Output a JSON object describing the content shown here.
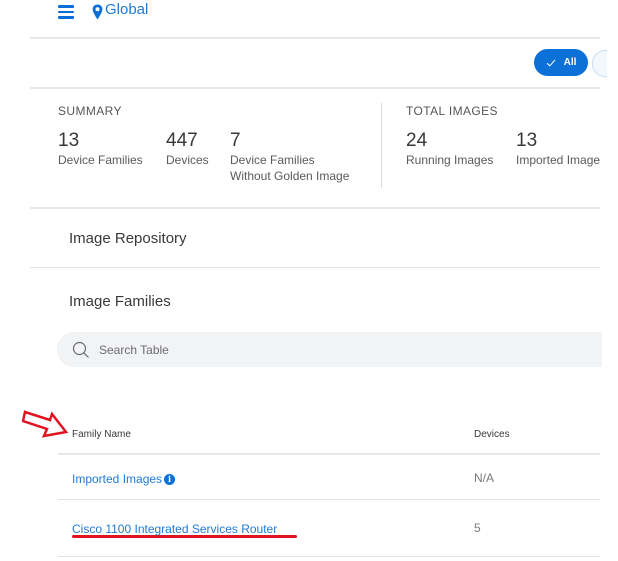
{
  "header": {
    "location_label": "Global"
  },
  "filter": {
    "selected_label": "All"
  },
  "summary": {
    "title": "SUMMARY",
    "metrics": [
      {
        "value": "13",
        "label": "Device Families"
      },
      {
        "value": "447",
        "label": "Devices"
      },
      {
        "value": "7",
        "label": "Device Families",
        "label2": "Without Golden Image"
      }
    ]
  },
  "total_images": {
    "title": "TOTAL IMAGES",
    "metrics": [
      {
        "value": "24",
        "label": "Running Images"
      },
      {
        "value": "13",
        "label": "Imported Images"
      }
    ]
  },
  "sections": {
    "image_repository": "Image Repository",
    "image_families": "Image Families"
  },
  "search": {
    "placeholder": "Search Table",
    "value": ""
  },
  "table": {
    "columns": [
      "Family Name",
      "Devices"
    ],
    "rows": [
      {
        "family_name": "Imported Images",
        "has_info": true,
        "devices": "N/A"
      },
      {
        "family_name": "Cisco 1100 Integrated Services Router",
        "has_info": false,
        "devices": "5"
      }
    ]
  },
  "annotations": {
    "arrow_color": "#e0141e",
    "underline_color": "#e0141e"
  },
  "colors": {
    "accent": "#0b70d8",
    "link": "#1e7ad8"
  }
}
